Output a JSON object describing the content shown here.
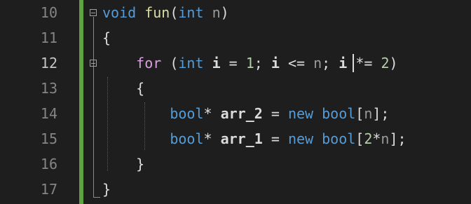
{
  "editor": {
    "line_numbers": [
      "10",
      "11",
      "12",
      "13",
      "14",
      "15",
      "16",
      "17"
    ],
    "active_line": "12",
    "lines": [
      {
        "tokens": [
          [
            "kw",
            "void"
          ],
          [
            "punc",
            " "
          ],
          [
            "fn",
            "fun"
          ],
          [
            "punc",
            "("
          ],
          [
            "kw",
            "int"
          ],
          [
            "punc",
            " "
          ],
          [
            "param",
            "n"
          ],
          [
            "punc",
            ")"
          ]
        ]
      },
      {
        "tokens": [
          [
            "punc",
            "{"
          ]
        ]
      },
      {
        "tokens": [
          [
            "punc",
            "    "
          ],
          [
            "ctl",
            "for"
          ],
          [
            "punc",
            " ("
          ],
          [
            "kw",
            "int"
          ],
          [
            "punc",
            " "
          ],
          [
            "var",
            "i"
          ],
          [
            "punc",
            " = "
          ],
          [
            "num",
            "1"
          ],
          [
            "punc",
            "; "
          ],
          [
            "var",
            "i"
          ],
          [
            "punc",
            " <= "
          ],
          [
            "param",
            "n"
          ],
          [
            "punc",
            "; "
          ],
          [
            "var",
            "i"
          ],
          [
            "punc",
            " *= "
          ],
          [
            "num",
            "2"
          ],
          [
            "punc",
            ")"
          ]
        ]
      },
      {
        "tokens": [
          [
            "punc",
            "    {"
          ]
        ]
      },
      {
        "tokens": [
          [
            "punc",
            "        "
          ],
          [
            "kw",
            "bool"
          ],
          [
            "punc",
            "* "
          ],
          [
            "var",
            "arr_2"
          ],
          [
            "punc",
            " = "
          ],
          [
            "kw",
            "new"
          ],
          [
            "punc",
            " "
          ],
          [
            "kw",
            "bool"
          ],
          [
            "punc",
            "["
          ],
          [
            "param",
            "n"
          ],
          [
            "punc",
            "];"
          ]
        ]
      },
      {
        "tokens": [
          [
            "punc",
            "        "
          ],
          [
            "kw",
            "bool"
          ],
          [
            "punc",
            "* "
          ],
          [
            "var",
            "arr_1"
          ],
          [
            "punc",
            " = "
          ],
          [
            "kw",
            "new"
          ],
          [
            "punc",
            " "
          ],
          [
            "kw",
            "bool"
          ],
          [
            "punc",
            "["
          ],
          [
            "num",
            "2"
          ],
          [
            "punc",
            "*"
          ],
          [
            "param",
            "n"
          ],
          [
            "punc",
            "];"
          ]
        ]
      },
      {
        "tokens": [
          [
            "punc",
            "    }"
          ]
        ]
      },
      {
        "tokens": [
          [
            "punc",
            "}"
          ]
        ]
      }
    ],
    "colors": {
      "background": "#1e1e1e",
      "change_bar": "#5ea33e",
      "keyword": "#569cd6",
      "control_keyword": "#d8a0df",
      "function": "#dcdcaa",
      "number": "#b5cea8"
    }
  }
}
